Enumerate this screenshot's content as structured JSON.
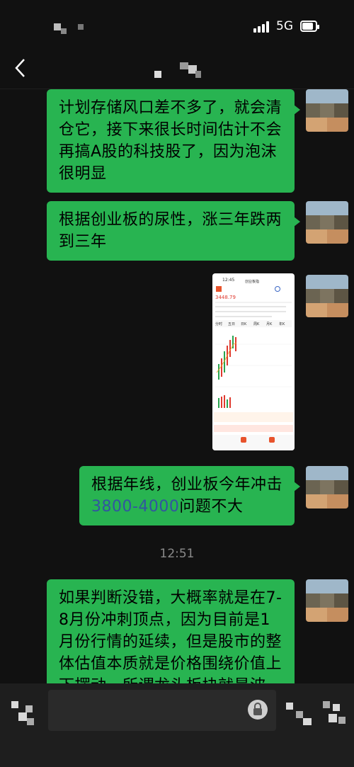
{
  "status_bar": {
    "network": "5G"
  },
  "messages": [
    {
      "text": "计划存储风口差不多了，就会清仓它，接下来很长时间估计不会再搞A股的科技股了，因为泡沫很明显"
    },
    {
      "text": "根据创业板的尿性，涨三年跌两到三年"
    },
    {
      "screenshot": {
        "time": "12:45",
        "name": "创业板指",
        "price": "3448.79",
        "tabs": [
          "分时",
          "五日",
          "日K",
          "周K",
          "月K",
          "年K"
        ]
      }
    },
    {
      "text_before": "根据年线，创业板今年冲击",
      "link": "3800-4000",
      "text_after": "问题不大"
    },
    {
      "text": "如果判断没错，大概率就是在7-8月份冲刺顶点，因为目前是1月份行情的延续，但是股市的整体估值本质就是价格围绕价值上下摆动，所谓龙头板块就是波"
    }
  ],
  "timestamp": "12:51"
}
